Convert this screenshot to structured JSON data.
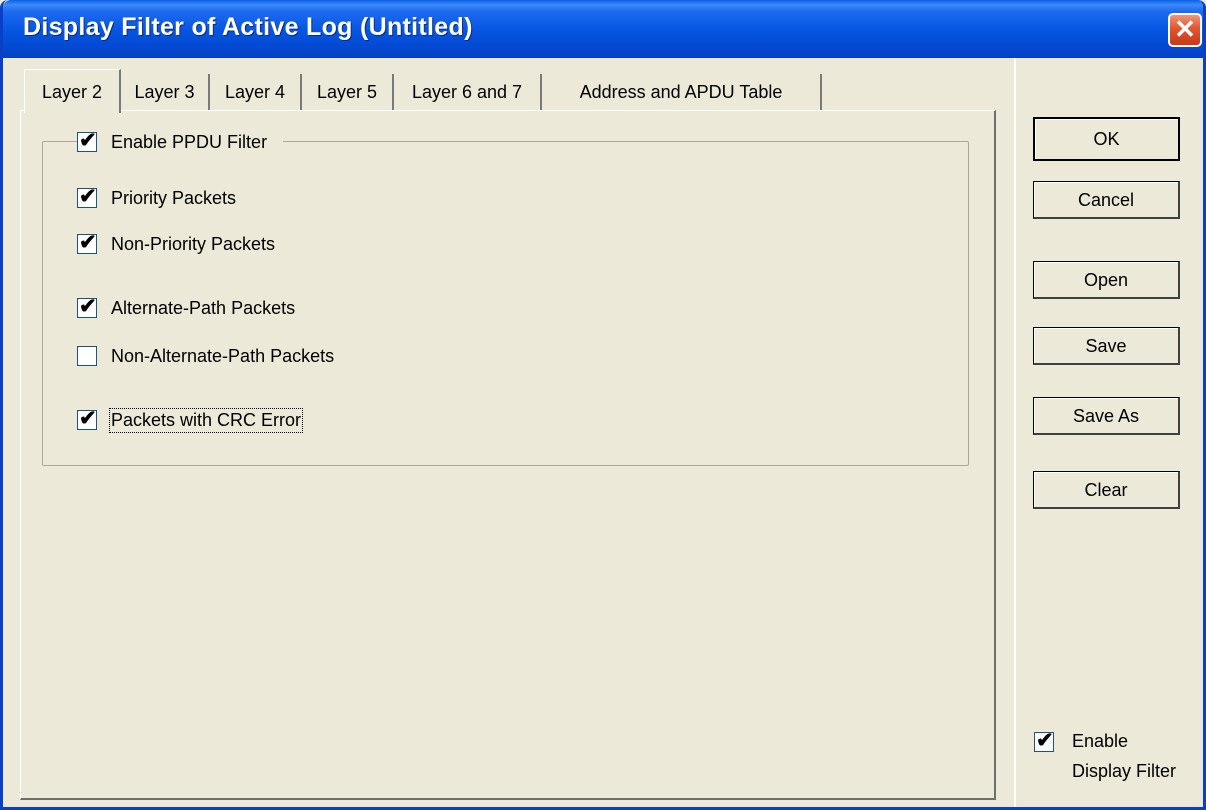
{
  "window": {
    "title": "Display Filter of Active Log (Untitled)",
    "close_glyph": "✕"
  },
  "tabs": [
    {
      "label": "Layer 2",
      "active": true
    },
    {
      "label": "Layer 3",
      "active": false
    },
    {
      "label": "Layer 4",
      "active": false
    },
    {
      "label": "Layer 5",
      "active": false
    },
    {
      "label": "Layer 6 and 7",
      "active": false
    },
    {
      "label": "Address and APDU Table",
      "active": false
    }
  ],
  "group": {
    "header": {
      "label": "Enable PPDU Filter",
      "checked": true
    },
    "options": [
      {
        "label": "Priority Packets",
        "checked": true
      },
      {
        "label": "Non-Priority Packets",
        "checked": true
      },
      {
        "label": "Alternate-Path Packets",
        "checked": true
      },
      {
        "label": "Non-Alternate-Path Packets",
        "checked": false
      },
      {
        "label": "Packets with CRC Error",
        "checked": true,
        "focused": true
      }
    ]
  },
  "buttons": {
    "ok": "OK",
    "cancel": "Cancel",
    "open": "Open",
    "save": "Save",
    "save_as": "Save As",
    "clear": "Clear"
  },
  "enable_display_filter": {
    "line1": "Enable",
    "line2": "Display Filter",
    "checked": true
  },
  "check_glyph": "✔",
  "colors": {
    "titlebar": "#0554E1",
    "dialog_bg": "#ECE9D8",
    "close_button": "#E0562F"
  }
}
